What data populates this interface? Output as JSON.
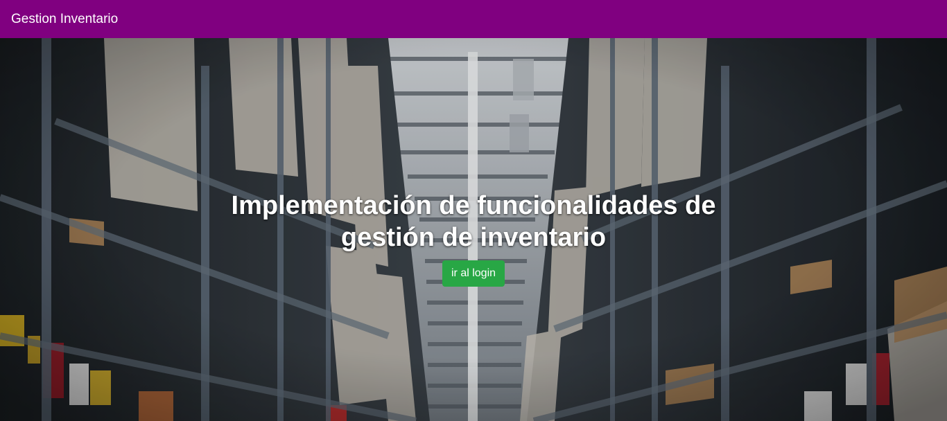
{
  "navbar": {
    "brand": "Gestion Inventario",
    "background_color": "#800080"
  },
  "hero": {
    "background_image": "warehouse-aisle-photo",
    "headline": "Implementación de funcionalidades de gestión de inventario",
    "login_button": {
      "label": "ir al login",
      "color": "#28a745"
    }
  }
}
